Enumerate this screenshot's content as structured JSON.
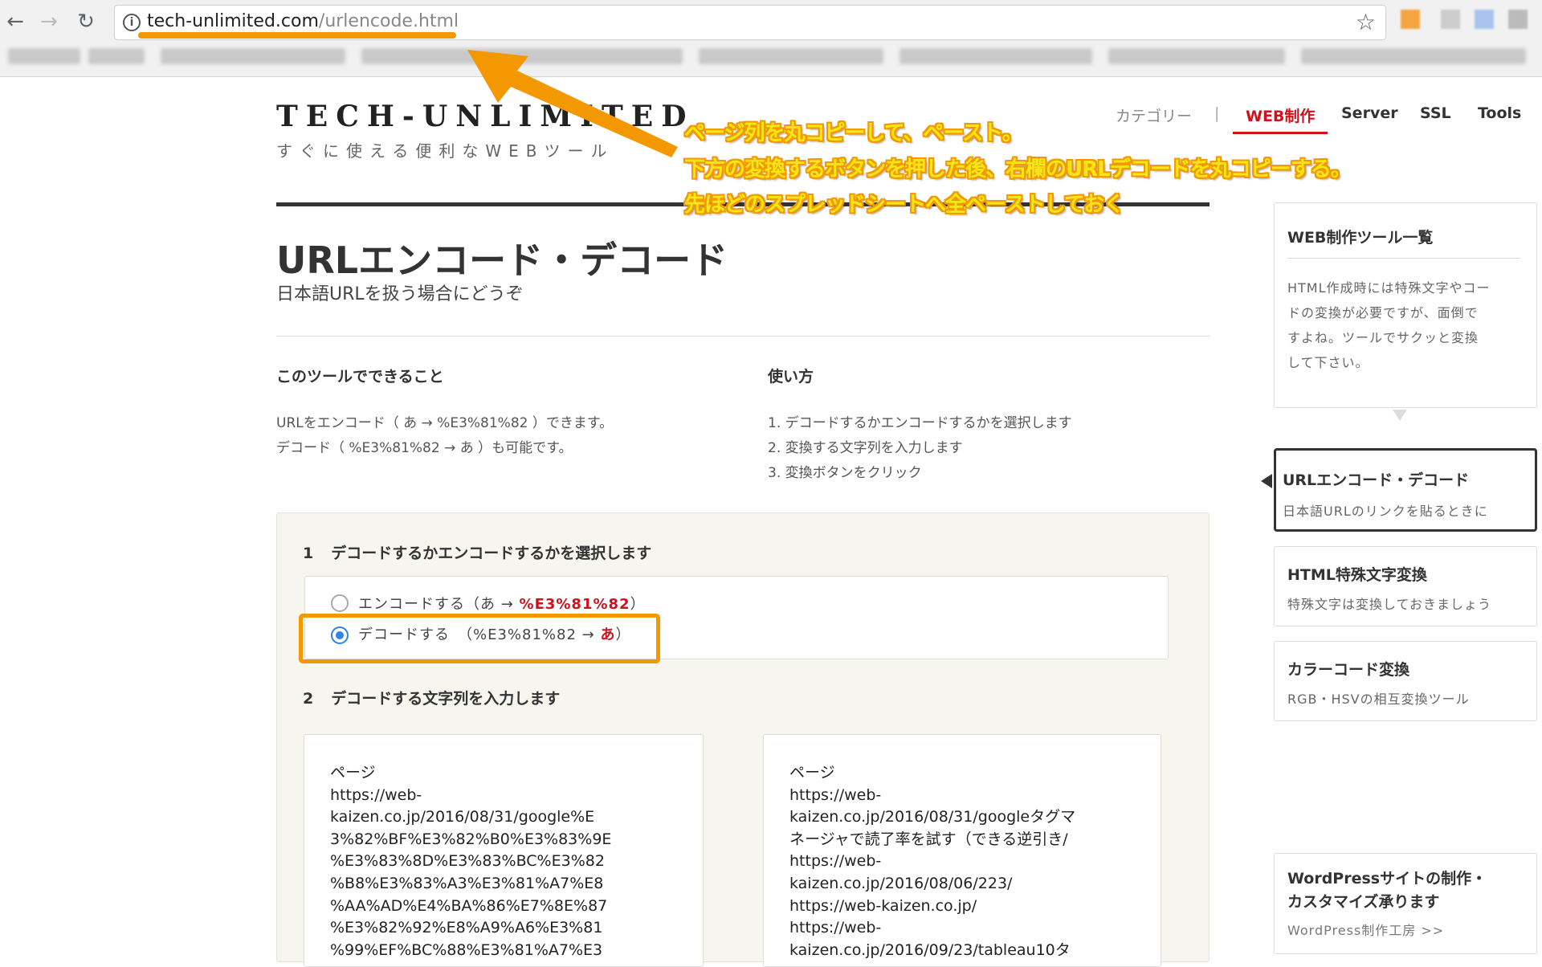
{
  "browser": {
    "back_glyph": "←",
    "forward_glyph": "→",
    "reload_glyph": "↻",
    "info_glyph": "i",
    "url_host": "tech-unlimited.com",
    "url_path": "/urlencode.html",
    "star_glyph": "☆"
  },
  "header": {
    "logo_title": "TECH-UNLIMITED",
    "logo_subtitle": "すぐに使える便利なWEBツール",
    "nav": {
      "category": "カテゴリー",
      "separator": "|",
      "web": "WEB制作",
      "server": "Server",
      "ssl": "SSL",
      "tools": "Tools"
    }
  },
  "main": {
    "title": "URLエンコード・デコード",
    "subtitle": "日本語URLを扱う場合にどうぞ",
    "can_do": {
      "heading": "このツールでできること",
      "line1": "URLをエンコード（ あ → %E3%81%82 ）できます。",
      "line2": "デコード（ %E3%81%82 → あ ）も可能です。"
    },
    "how_to": {
      "heading": "使い方",
      "steps": [
        "1. デコードするかエンコードするかを選択します",
        "2. 変換する文字列を入力します",
        "3. 変換ボタンをクリック"
      ]
    },
    "tool": {
      "step1_num": "1",
      "step1_label": "デコードするかエンコードするかを選択します",
      "encode_label": "エンコードする（あ → ",
      "encode_example": "%E3%81%82",
      "encode_close": "）",
      "decode_label": "デコードする　（%E3%81%82 → ",
      "decode_example": "あ",
      "decode_close": "）",
      "step2_num": "2",
      "step2_label": "デコードする文字列を入力します",
      "input_text": "ページ\nhttps://web-\nkaizen.co.jp/2016/08/31/google%E\n3%82%BF%E3%82%B0%E3%83%9E\n%E3%83%8D%E3%83%BC%E3%82\n%B8%E3%83%A3%E3%81%A7%E8\n%AA%AD%E4%BA%86%E7%8E%87\n%E3%82%92%E8%A9%A6%E3%81\n%99%EF%BC%88%E3%81%A7%E3",
      "output_text": "ページ\nhttps://web-\nkaizen.co.jp/2016/08/31/googleタグマ\nネージャで読了率を試す（できる逆引き/\nhttps://web-\nkaizen.co.jp/2016/08/06/223/\nhttps://web-kaizen.co.jp/\nhttps://web-\nkaizen.co.jp/2016/09/23/tableau10タ"
    }
  },
  "sidebar": {
    "intro": {
      "title": "WEB制作ツール一覧",
      "lines": [
        "HTML作成時には特殊文字やコー",
        "ドの変換が必要ですが、面倒で",
        "すよね。ツールでサクッと変換",
        "して下さい。"
      ]
    },
    "items": [
      {
        "title": "URLエンコード・デコード",
        "desc": "日本語URLのリンクを貼るときに"
      },
      {
        "title": "HTML特殊文字変換",
        "desc": "特殊文字は変換しておきましょう"
      },
      {
        "title": "カラーコード変換",
        "desc": "RGB・HSVの相互変換ツール"
      },
      {
        "title_line1": "WordPressサイトの制作・",
        "title_line2": "カスタマイズ承ります",
        "desc": "WordPress制作工房 >>"
      }
    ]
  },
  "annotations": [
    "ページ列を丸コピーして、ペースト。",
    "下方の変換するボタンを押した後、右欄のURLデコードを丸コピーする。",
    "先ほどのスプレッドシートへ全ペーストしておく"
  ],
  "colors": {
    "annotation_orange": "#f39800",
    "accent_red": "#d0111b",
    "radio_blue": "#2d83e8"
  }
}
